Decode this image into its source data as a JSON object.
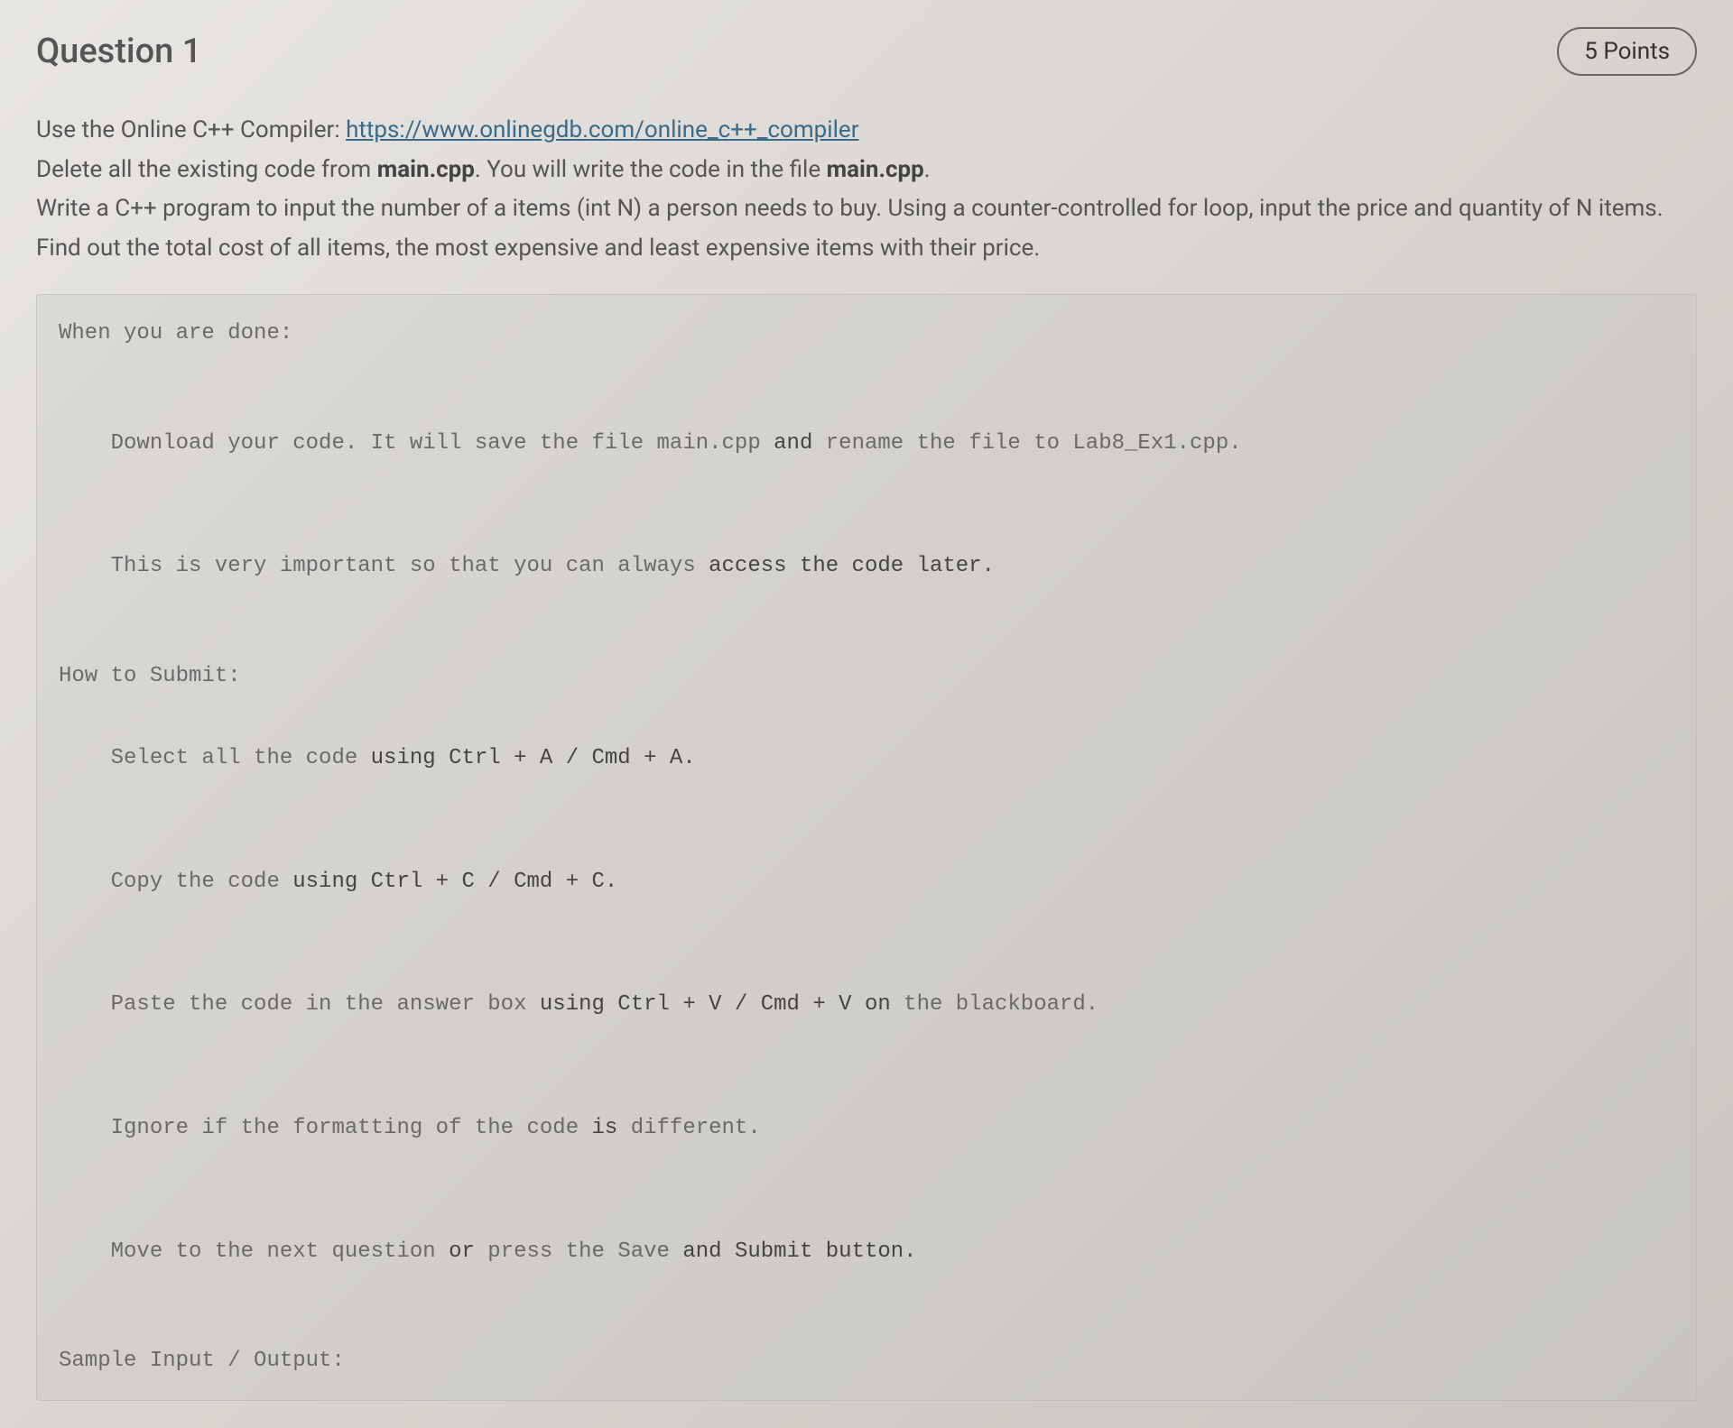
{
  "header": {
    "title": "Question 1",
    "points": "5 Points"
  },
  "body": {
    "line1_prefix": "Use the Online C++ Compiler: ",
    "line1_link": "https://www.onlinegdb.com/online_c++_compiler",
    "line2_a": "Delete all the existing code from ",
    "line2_b": "main.cpp",
    "line2_c": ". You will write the code in the file ",
    "line2_d": "main.cpp",
    "line2_e": ".",
    "line3": "Write a C++ program to input the number of a items (int N) a person needs to buy. Using a counter-controlled for loop, input the price and quantity of N items.",
    "line4": "Find out the total cost of all items, the most expensive and least expensive items with their price."
  },
  "code": {
    "l1": "When you are done:",
    "l2_a": "Download your code. It will save the file main.cpp ",
    "l2_b": "and",
    "l2_c": " rename the file to Lab8_Ex1.cpp.",
    "l3_a": "This is very important so that you can always ",
    "l3_b": "access the code later.",
    "l4": "How to Submit:",
    "l5_a": "Select all the code ",
    "l5_b": "using Ctrl + A / Cmd + A.",
    "l6_a": "Copy the code ",
    "l6_b": "using Ctrl + C / Cmd + C.",
    "l7_a": "Paste the code in the answer box ",
    "l7_b": "using Ctrl + V / Cmd + V on",
    "l7_c": " the blackboard.",
    "l8_a": "Ignore if the formatting of the code ",
    "l8_b": "is",
    "l8_c": " different.",
    "l9_a": "Move to the next question ",
    "l9_b": "or",
    "l9_c": " press the Save ",
    "l9_d": "and Submit button.",
    "l10": "Sample Input / Output:"
  }
}
